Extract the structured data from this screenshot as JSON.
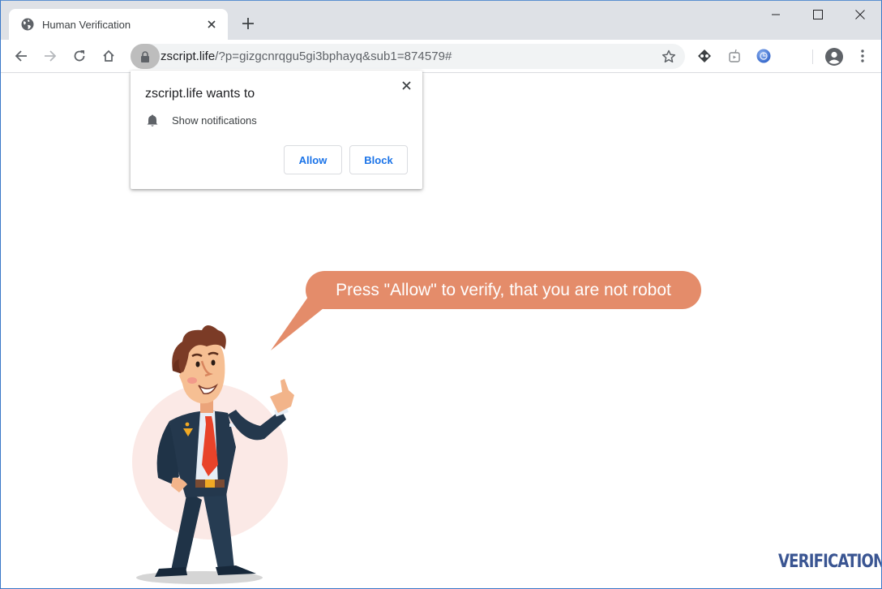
{
  "browser": {
    "tab": {
      "title": "Human Verification",
      "favicon": "globe-icon",
      "close_icon": "close-icon"
    },
    "new_tab_icon": "plus-icon",
    "window_controls": [
      "minimize-icon",
      "maximize-icon",
      "close-icon"
    ],
    "toolbar": {
      "back_icon": "arrow-left-icon",
      "forward_icon": "arrow-right-icon",
      "reload_icon": "reload-icon",
      "home_icon": "home-icon",
      "lock_icon": "lock-icon",
      "url_host": "zscript.life",
      "url_rest": "/?p=gizgcnrqgu5gi3bphayq&sub1=874579#",
      "bookmark_icon": "star-icon",
      "extensions": [
        "extension-diamond-icon",
        "extension-tv-icon",
        "extension-blue-globe-icon"
      ],
      "profile_icon": "account-circle-icon",
      "menu_icon": "more-vert-icon"
    }
  },
  "permission_popup": {
    "title": "zscript.life wants to",
    "permission_icon": "bell-icon",
    "permission_label": "Show notifications",
    "allow_label": "Allow",
    "block_label": "Block",
    "close_icon": "close-icon"
  },
  "page": {
    "bubble_text": "Press \"Allow\" to verify, that you are not robot",
    "logo_text": "VERIFICATION",
    "illustration": "businessman-pointing-up-illustration"
  },
  "colors": {
    "bubble": "#e48c6a",
    "logo": "#3a5592",
    "button_text": "#1a73e8",
    "chrome_frame": "#dee1e6"
  }
}
